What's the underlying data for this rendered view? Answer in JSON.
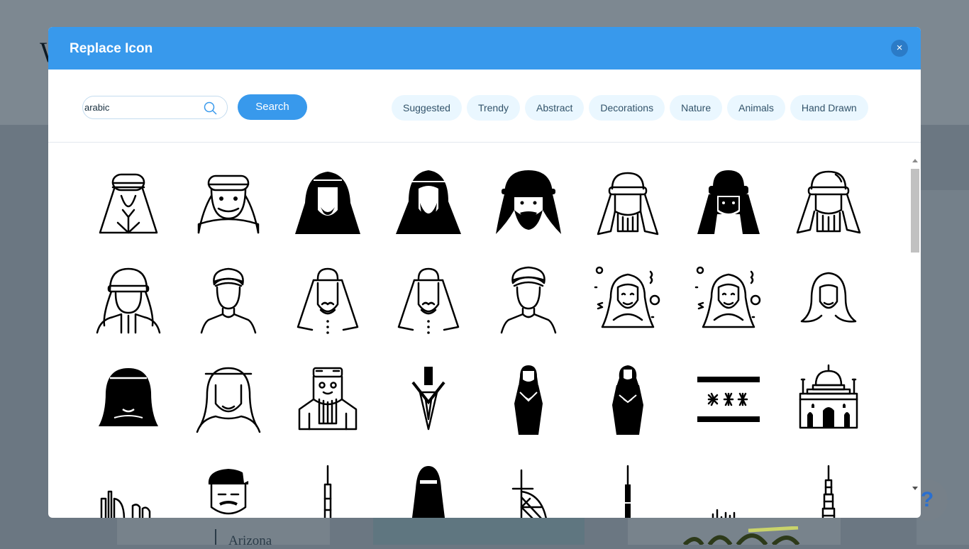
{
  "modal": {
    "title": "Replace Icon",
    "close_glyph": "×"
  },
  "search": {
    "value": "arabic",
    "button_label": "Search"
  },
  "categories": [
    "Suggested",
    "Trendy",
    "Abstract",
    "Decorations",
    "Nature",
    "Animals",
    "Hand Drawn"
  ],
  "icons": [
    [
      "arab-man-outline-icon",
      "arab-man-headband-icon",
      "arab-man-hood-solid-icon",
      "arab-man-beard-solid-icon",
      "arab-man-keffiyeh-solid-icon",
      "arab-man-keffiyeh-outline-icon",
      "arab-man-dark-face-icon",
      "arab-man-agal-outline-icon"
    ],
    [
      "arab-man-long-hair-icon",
      "turban-man-icon",
      "arab-man-beard-outline-icon",
      "arab-man-beard-outline-2-icon",
      "turban-man-2-icon",
      "hijab-woman-decor-icon",
      "hijab-woman-decor-2-icon",
      "hijab-woman-icon"
    ],
    [
      "woman-headscarf-solid-icon",
      "woman-headscarf-outline-icon",
      "arab-man-cap-icon",
      "dagger-icon",
      "woman-abaya-icon",
      "woman-abaya-2-icon",
      "iraq-flag-icon",
      "mosque-icon"
    ],
    [
      "city-skyline-icon",
      "soldier-beret-icon",
      "burj-khalifa-icon",
      "niqab-woman-icon",
      "burj-al-arab-icon",
      "tower-icon",
      "skyline-small-icon",
      "skyscraper-icon"
    ]
  ],
  "background": {
    "card_text": "Arizona",
    "letter": "W",
    "help": "?"
  }
}
